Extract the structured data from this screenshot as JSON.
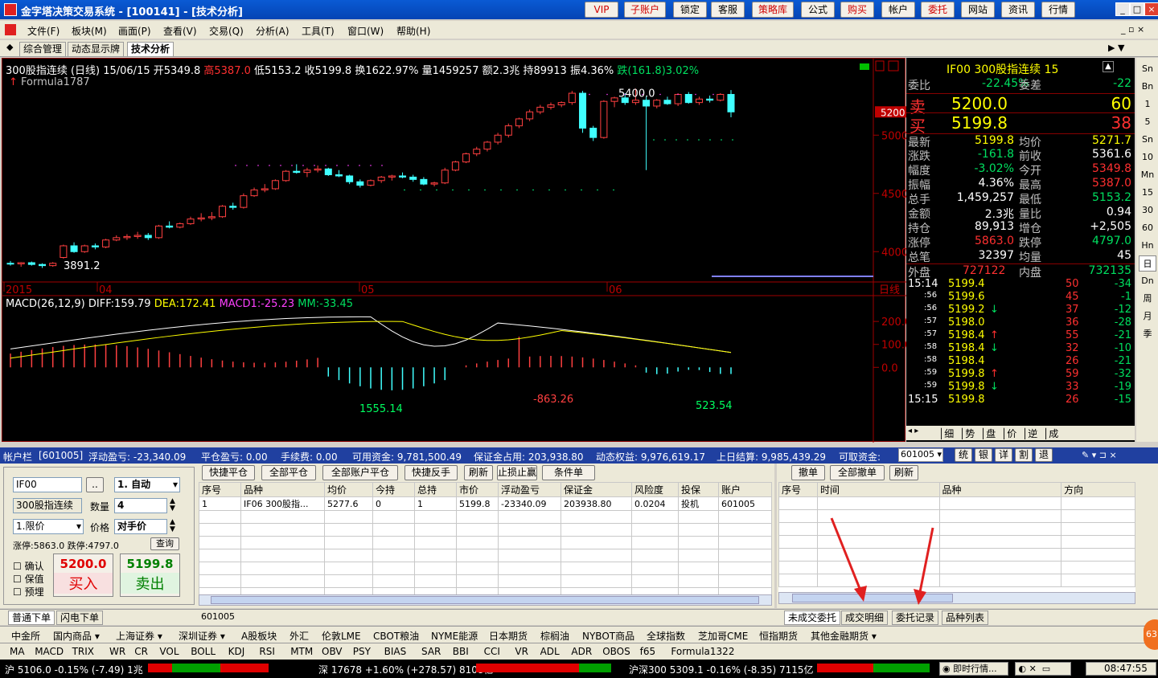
{
  "app": {
    "title": "金字塔决策交易系统 - [100141] - [技术分析]",
    "vip": "VIP",
    "buttons": [
      "子账户",
      "锁定",
      "客服",
      "策略库",
      "公式",
      "购买",
      "帐户",
      "委托",
      "网站",
      "资讯",
      "行情"
    ],
    "red_buttons": [
      "VIP",
      "子账户",
      "策略库",
      "购买",
      "委托"
    ]
  },
  "menu": [
    "文件(F)",
    "板块(M)",
    "画面(P)",
    "查看(V)",
    "交易(Q)",
    "分析(A)",
    "工具(T)",
    "窗口(W)",
    "帮助(H)"
  ],
  "tabs": [
    "综合管理",
    "动态显示牌",
    "技术分析"
  ],
  "chart": {
    "header": {
      "name": "300股指连续 (日线) 15/06/15",
      "open": "开5349.8",
      "high": "高5387.0",
      "low": "低5153.2",
      "close": "收5199.8",
      "turnover": "换1622.97%",
      "volume": "量1459257",
      "amount": "额2.3兆",
      "hold": "持89913",
      "amplitude": "振4.36%",
      "change": "跌(161.8)3.02%"
    },
    "formula": "Formula1787",
    "price_label": "5200",
    "annot_high": "5400.0",
    "annot_low": "3891.2",
    "yticks": [
      "5000",
      "4500",
      "4000"
    ],
    "xticks": [
      "2015",
      "04",
      "05",
      "06"
    ],
    "period_label": "日线",
    "macd": {
      "title": "MACD(26,12,9)",
      "diff": "DIFF:159.79",
      "dea": "DEA:172.41",
      "macd1": "MACD1:-25.23",
      "mm": "MM:-33.45",
      "yticks": [
        "200.0",
        "100.0",
        "0.0"
      ],
      "labels": [
        "1555.14",
        "-863.26",
        "523.54"
      ]
    }
  },
  "chart_data": [
    {
      "type": "candlestick",
      "title": "300股指连续 (日线)",
      "ylim": [
        3850,
        5450
      ],
      "ohlc_approx": [
        [
          3900,
          3920,
          3880,
          3895
        ],
        [
          3895,
          3910,
          3870,
          3905
        ],
        [
          3905,
          3915,
          3880,
          3890
        ],
        [
          3890,
          3900,
          3860,
          3880
        ],
        [
          3880,
          3910,
          3870,
          3900
        ],
        [
          3950,
          4060,
          3940,
          4050
        ],
        [
          4050,
          4080,
          3990,
          4000
        ],
        [
          4000,
          4060,
          3990,
          4050
        ],
        [
          4050,
          4070,
          4020,
          4040
        ],
        [
          4040,
          4110,
          4030,
          4100
        ],
        [
          4100,
          4140,
          4090,
          4120
        ],
        [
          4120,
          4150,
          4100,
          4130
        ],
        [
          4130,
          4170,
          4110,
          4140
        ],
        [
          4140,
          4160,
          4100,
          4120
        ],
        [
          4120,
          4230,
          4110,
          4220
        ],
        [
          4220,
          4260,
          4200,
          4210
        ],
        [
          4210,
          4250,
          4200,
          4240
        ],
        [
          4240,
          4300,
          4230,
          4280
        ],
        [
          4280,
          4330,
          4260,
          4290
        ],
        [
          4290,
          4340,
          4270,
          4300
        ],
        [
          4300,
          4400,
          4290,
          4390
        ],
        [
          4390,
          4420,
          4360,
          4380
        ],
        [
          4380,
          4500,
          4370,
          4480
        ],
        [
          4480,
          4550,
          4470,
          4530
        ],
        [
          4530,
          4580,
          4510,
          4540
        ],
        [
          4540,
          4620,
          4530,
          4610
        ],
        [
          4610,
          4700,
          4600,
          4690
        ],
        [
          4690,
          4750,
          4670,
          4680
        ],
        [
          4680,
          4720,
          4640,
          4700
        ],
        [
          4700,
          4740,
          4680,
          4710
        ],
        [
          4710,
          4720,
          4650,
          4660
        ],
        [
          4660,
          4700,
          4640,
          4650
        ],
        [
          4650,
          4660,
          4580,
          4600
        ],
        [
          4600,
          4620,
          4550,
          4570
        ],
        [
          4570,
          4620,
          4560,
          4610
        ],
        [
          4610,
          4650,
          4590,
          4640
        ],
        [
          4640,
          4660,
          4610,
          4650
        ],
        [
          4650,
          4680,
          4630,
          4640
        ],
        [
          4640,
          4660,
          4600,
          4620
        ],
        [
          4620,
          4640,
          4570,
          4580
        ],
        [
          4580,
          4600,
          4560,
          4590
        ],
        [
          4590,
          4720,
          4580,
          4700
        ],
        [
          4700,
          4780,
          4690,
          4770
        ],
        [
          4770,
          4850,
          4760,
          4840
        ],
        [
          4840,
          4900,
          4820,
          4880
        ],
        [
          4880,
          4950,
          4860,
          4940
        ],
        [
          4940,
          5020,
          4920,
          5000
        ],
        [
          5000,
          5100,
          4980,
          5080
        ],
        [
          5080,
          5150,
          5060,
          5140
        ],
        [
          5140,
          5220,
          5120,
          5200
        ],
        [
          5200,
          5260,
          5180,
          5240
        ],
        [
          5240,
          5280,
          5220,
          5260
        ],
        [
          5260,
          5290,
          5240,
          5280
        ],
        [
          5280,
          5380,
          5260,
          5360
        ],
        [
          5360,
          5380,
          5020,
          5060
        ],
        [
          5060,
          5080,
          4950,
          4980
        ],
        [
          4980,
          5300,
          4970,
          5290
        ],
        [
          5290,
          5330,
          5240,
          5320
        ],
        [
          5320,
          5360,
          5260,
          5280
        ],
        [
          5280,
          5400,
          5260,
          5300
        ],
        [
          5300,
          5330,
          4700,
          5250
        ],
        [
          5250,
          5310,
          5230,
          5300
        ],
        [
          5300,
          5330,
          5260,
          5270
        ],
        [
          5270,
          5360,
          5250,
          5350
        ],
        [
          5350,
          5370,
          5270,
          5280
        ],
        [
          5280,
          5330,
          5260,
          5310
        ],
        [
          5310,
          5340,
          5280,
          5300
        ],
        [
          5300,
          5360,
          5290,
          5350
        ],
        [
          5349.8,
          5387,
          5153.2,
          5199.8
        ]
      ]
    },
    {
      "type": "line",
      "title": "MACD(26,12,9)",
      "ylim": [
        -300,
        260
      ],
      "series": [
        {
          "name": "DIFF",
          "color": "#ffffff"
        },
        {
          "name": "DEA",
          "color": "#ffff00"
        }
      ]
    }
  ],
  "quote": {
    "symbol": "IF00 300股指连续 15",
    "weibi_label": "委比",
    "weibi": "-22.45%",
    "weicha_label": "委差",
    "weicha": "-22",
    "sell_label": "卖",
    "sell_price": "5200.0",
    "sell_vol": "60",
    "buy_label": "买",
    "buy_price": "5199.8",
    "buy_vol": "38",
    "rows": [
      [
        "最新",
        "5199.8",
        "均价",
        "5271.7"
      ],
      [
        "涨跌",
        "-161.8",
        "前收",
        "5361.6"
      ],
      [
        "幅度",
        "-3.02%",
        "今开",
        "5349.8"
      ],
      [
        "振幅",
        "4.36%",
        "最高",
        "5387.0"
      ],
      [
        "总手",
        "1,459,257",
        "最低",
        "5153.2"
      ],
      [
        "金额",
        "2.3兆",
        "量比",
        "0.94"
      ],
      [
        "持仓",
        "89,913",
        "增仓",
        "+2,505"
      ],
      [
        "涨停",
        "5863.0",
        "跌停",
        "4797.0"
      ],
      [
        "总笔",
        "32397",
        "均量",
        "45"
      ]
    ],
    "outer_label": "外盘",
    "outer": "727122",
    "inner_label": "内盘",
    "inner": "732135",
    "ticks": [
      [
        "15:14",
        "5199.4",
        "",
        "50",
        "-34"
      ],
      [
        ":56",
        "5199.6",
        "",
        "45",
        "-1"
      ],
      [
        ":56",
        "5199.2",
        "↓",
        "37",
        "-12"
      ],
      [
        ":57",
        "5198.0",
        "",
        "36",
        "-28"
      ],
      [
        ":57",
        "5198.4",
        "↑",
        "55",
        "-21"
      ],
      [
        ":58",
        "5198.4",
        "↓",
        "32",
        "-10"
      ],
      [
        ":58",
        "5198.4",
        "",
        "26",
        "-21"
      ],
      [
        ":59",
        "5199.8",
        "↑",
        "59",
        "-32"
      ],
      [
        ":59",
        "5199.8",
        "↓",
        "33",
        "-19"
      ],
      [
        "15:15",
        "5199.8",
        "",
        "26",
        "-15"
      ]
    ],
    "bottom_tabs": [
      "细",
      "势",
      "盘",
      "价",
      "逆",
      "成"
    ]
  },
  "rightbar": [
    "Sn",
    "Bn",
    "1",
    "5",
    "Sn",
    "10",
    "Mn",
    "15",
    "30",
    "60",
    "Hn",
    "日",
    "Dn",
    "周",
    "月",
    "季"
  ],
  "account": {
    "label": "帐户栏",
    "id": "[601005]",
    "float_pl": "浮动盈亏: -23,340.09",
    "close_pl": "平仓盈亏: 0.00",
    "fee": "手续费: 0.00",
    "available": "可用资金: 9,781,500.49",
    "margin": "保证金占用: 203,938.80",
    "equity": "动态权益: 9,976,619.17",
    "last_settle": "上日结算: 9,985,439.29",
    "withdraw": "可取资金:",
    "select": "601005",
    "tools": [
      "统",
      "银",
      "详",
      "割",
      "退"
    ]
  },
  "order": {
    "symbol": "IF00",
    "ellipsis": "..",
    "mode": "1. 自动",
    "name": "300股指连续",
    "qty_label": "数量",
    "qty": "4",
    "price_type": "1.限价",
    "price_label": "价格",
    "price": "对手价",
    "limit": "涨停:5863.0 跌停:4797.0",
    "query": "查询",
    "confirm": "确认",
    "keep": "保值",
    "pre": "预埋",
    "buy_price": "5200.0",
    "buy_label": "买入",
    "sell_price": "5199.8",
    "sell_label": "卖出"
  },
  "positions": {
    "buttons": [
      "快捷平仓",
      "全部平仓",
      "全部账户平仓",
      "快捷反手",
      "刷新",
      "止损止赢",
      "条件单"
    ],
    "headers": [
      "序号",
      "品种",
      "均价",
      "今持",
      "总持",
      "市价",
      "浮动盈亏",
      "保证金",
      "风险度",
      "投保",
      "账户"
    ],
    "rows": [
      [
        "1",
        "IF06 300股指...",
        "5277.6",
        "0",
        "1",
        "5199.8",
        "-23340.09",
        "203938.80",
        "0.0204",
        "投机",
        "601005"
      ]
    ],
    "footer": "601005"
  },
  "orders": {
    "buttons": [
      "撤单",
      "全部撤单",
      "刷新"
    ],
    "headers": [
      "序号",
      "时间",
      "品种",
      "方向"
    ]
  },
  "bottom_tabs_left": [
    "普通下单",
    "闪电下单"
  ],
  "bottom_tabs_right": [
    "未成交委托",
    "成交明细",
    "委托记录",
    "品种列表"
  ],
  "markets": [
    "中金所",
    "国内商品",
    "上海证券",
    "深圳证券",
    "A股板块",
    "外汇",
    "伦敦LME",
    "CBOT粮油",
    "NYME能源",
    "日本期货",
    "棕榈油",
    "NYBOT商品",
    "全球指数",
    "芝加哥CME",
    "恒指期货",
    "其他金融期货"
  ],
  "indicators": [
    "MA",
    "MACD",
    "TRIX",
    "WR",
    "CR",
    "VOL",
    "BOLL",
    "KDJ",
    "RSI",
    "MTM",
    "OBV",
    "PSY",
    "BIAS",
    "SAR",
    "BBI",
    "CCI",
    "VR",
    "ADL",
    "ADR",
    "OBOS",
    "f65",
    "Formula1322"
  ],
  "status": {
    "sh": "沪 5106.0 -0.15% (-7.49) 1兆",
    "sz": "深 17678 +1.60% (+278.57) 8108亿",
    "hs": "沪深300 5309.1 -0.16% (-8.35) 7115亿",
    "live": "即时行情...",
    "time": "08:47:55",
    "badge": "63"
  }
}
